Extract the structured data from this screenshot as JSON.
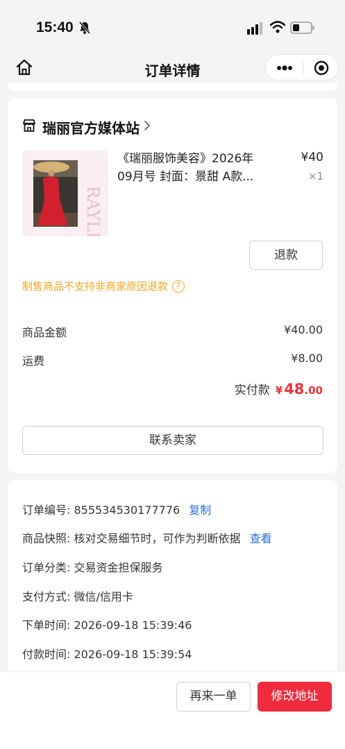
{
  "status_bar": {
    "time": "15:40"
  },
  "nav": {
    "title": "订单详情"
  },
  "shop": {
    "name": "瑞丽官方媒体站"
  },
  "product": {
    "title_line1": "《瑞丽服饰美容》2026年",
    "title_line2": "09月号 封面：景甜 A款...",
    "price": "¥40",
    "quantity": "×1",
    "cover_text": "RAYLI"
  },
  "refund_button": "退款",
  "notice": "制售商品不支持非商家原因退款",
  "summary": {
    "goods_label": "商品金额",
    "goods_value": "¥40.00",
    "shipping_label": "运费",
    "shipping_value": "¥8.00",
    "paid_label": "实付款",
    "paid_currency": "¥",
    "paid_int": "48",
    "paid_dec": ".00"
  },
  "contact_button": "联系卖家",
  "order_info": {
    "order_no_label": "订单编号:",
    "order_no": "855534530177776",
    "copy_link": "复制",
    "snapshot_label": "商品快照:",
    "snapshot_text": "核对交易细节时，可作为判断依据",
    "view_link": "查看",
    "category_label": "订单分类:",
    "category": "交易资金担保服务",
    "payment_label": "支付方式:",
    "payment": "微信/信用卡",
    "order_time_label": "下单时间:",
    "order_time": "2026-09-18 15:39:46",
    "pay_time_label": "付款时间:",
    "pay_time": "2026-09-18 15:39:54"
  },
  "bottom_bar": {
    "reorder_button": "再来一单",
    "edit_address_button": "修改地址"
  },
  "colors": {
    "accent_red": "#ee2c3d",
    "link_blue": "#2b6fd6",
    "notice_orange": "#f5a623"
  }
}
